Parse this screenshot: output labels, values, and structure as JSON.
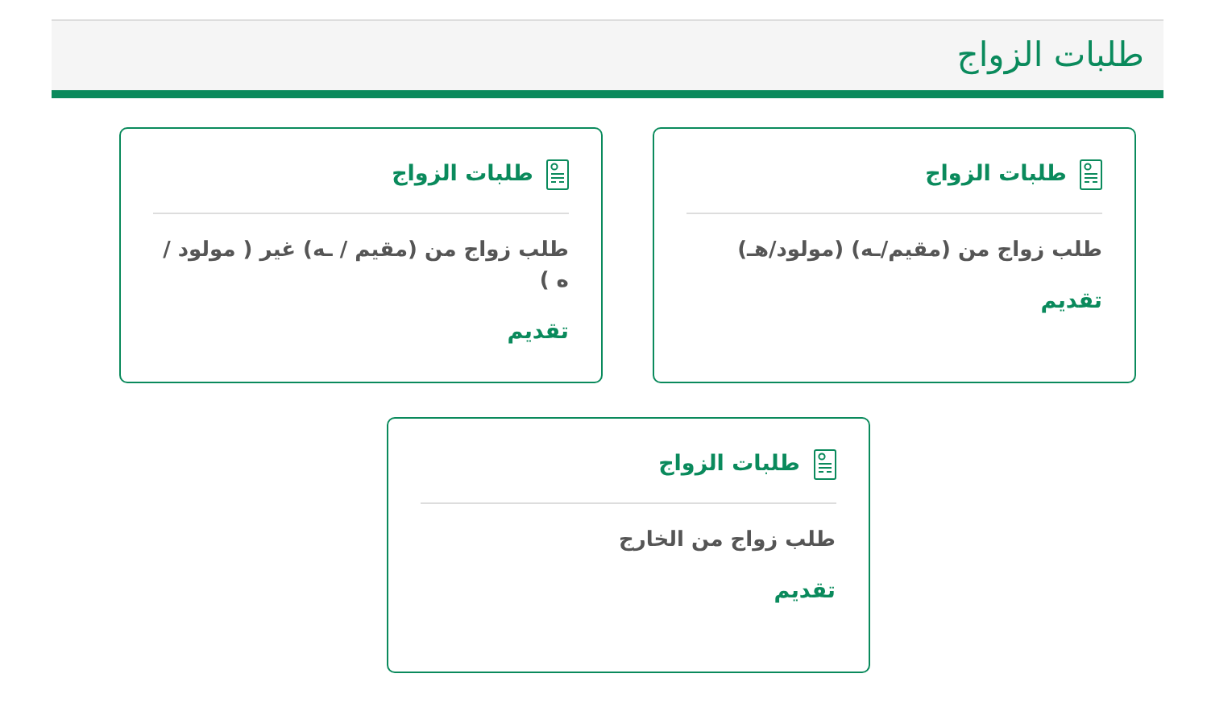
{
  "header": {
    "title": "طلبات الزواج"
  },
  "cards": [
    {
      "title": "طلبات الزواج",
      "description": "طلب زواج من (مقيم/ـه) (مولود/هـ)",
      "action": "تقديم"
    },
    {
      "title": "طلبات الزواج",
      "description": "طلب زواج من (مقيم / ـه) غير ( مولود /ه )",
      "action": "تقديم"
    },
    {
      "title": "طلبات الزواج",
      "description": "طلب زواج من الخارج",
      "action": "تقديم"
    }
  ]
}
